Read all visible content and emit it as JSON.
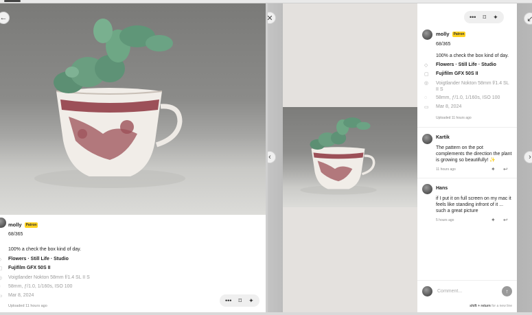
{
  "post": {
    "username": "molly",
    "badge": "Patron",
    "title": "68/365",
    "description": "100% a check the box kind of day.",
    "tags": "Flowers · Still Life · Studio",
    "camera": "Fujifilm GFX 50S II",
    "lens": "Voigtlander Nokton 58mm f/1.4 SL II S",
    "exposure": "58mm, ƒ/1.0, 1/160s, ISO 100",
    "date": "Mar 8, 2024",
    "uploaded": "Uploaded 11 hours ago"
  },
  "icons": {
    "back": "back-arrow-icon",
    "close": "close-icon",
    "prev": "chevron-left-icon",
    "next": "chevron-right-icon",
    "more": "more-icon",
    "bookmark": "bookmark-icon",
    "sparkle": "sparkle-icon",
    "tag": "tag-icon",
    "camera": "camera-icon",
    "location": "lens-icon",
    "aperture": "aperture-icon",
    "calendar": "calendar-icon",
    "reply": "reply-icon",
    "send": "send-icon"
  },
  "comments": [
    {
      "author": "Kartik",
      "text": "The pattern on the pot complements the direction the plant is growing so beautifully! ✨",
      "time": "11 hours ago"
    },
    {
      "author": "Hans",
      "text": "if I put it on full screen on my mac it feels like standing infront of it ... such a great picture",
      "time": "5 hours ago"
    }
  ],
  "composer": {
    "placeholder": "Comment...",
    "hint_key": "shift + return",
    "hint_text": " for a new line"
  },
  "colors": {
    "badge": "#ffd21f"
  }
}
